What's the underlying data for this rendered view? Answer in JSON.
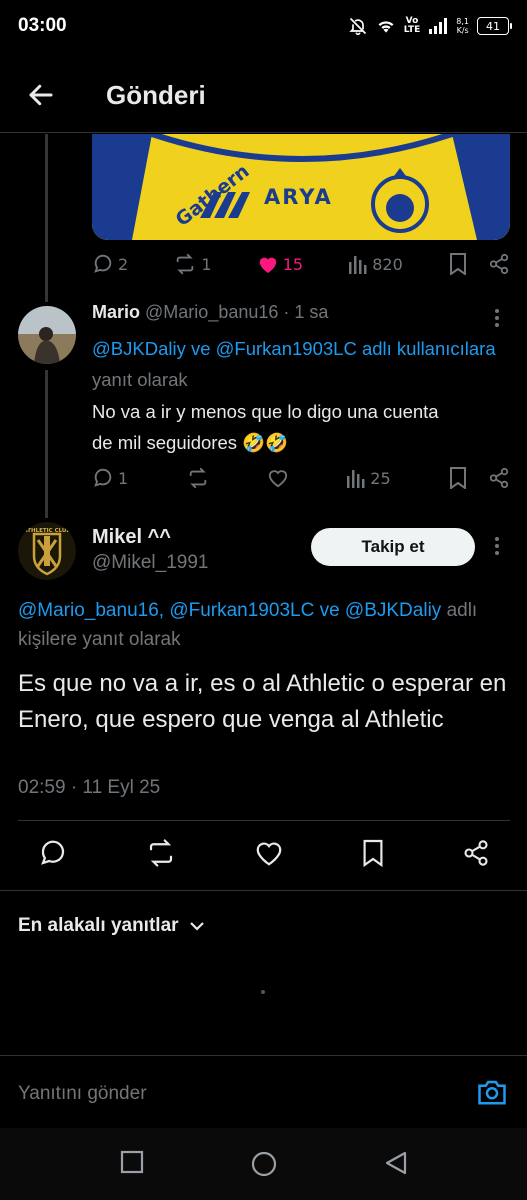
{
  "status_bar": {
    "time": "03:00",
    "vo": "Vo",
    "lte": "LTE",
    "net_speed_value": "8,1",
    "net_speed_unit": "K/s",
    "battery": "41"
  },
  "header": {
    "title": "Gönderi"
  },
  "parent_post": {
    "jersey_text": "ARYA",
    "stats": {
      "replies": "2",
      "reposts": "1",
      "likes": "15",
      "views": "820"
    },
    "like_color": "#f91880"
  },
  "reply_1": {
    "name": "Mario",
    "handle": "@Mario_banu16",
    "time": "· 1 sa",
    "reply_to_users": "@BJKDaliy ve @Furkan1903LC adlı kullanıcılara",
    "reply_to_suffix": "yanıt olarak",
    "text_line1": "No va a ir y menos que lo digo una cuenta",
    "text_line2": "de mil seguidores 🤣🤣",
    "stats": {
      "replies": "1",
      "views": "25"
    }
  },
  "main_post": {
    "name": "Mikel ^^",
    "handle": "@Mikel_1991",
    "follow_label": "Takip et",
    "reply_to_users": "@Mario_banu16, @Furkan1903LC ve @BJKDaliy",
    "reply_to_suffix_a": "adlı",
    "reply_to_suffix_b": "kişilere yanıt olarak",
    "text": "Es que no va a ir, es o al Athletic o esperar en Enero, que espero que venga al Athletic",
    "timestamp": "02:59 · 11 Eyl 25",
    "avatar_label": "ATHLETIC CLUB"
  },
  "sort": {
    "label": "En alakalı yanıtlar"
  },
  "composer": {
    "placeholder": "Yanıtını gönder"
  },
  "colors": {
    "accent": "#1d9bf0",
    "background": "#000000",
    "muted": "#71767b"
  }
}
